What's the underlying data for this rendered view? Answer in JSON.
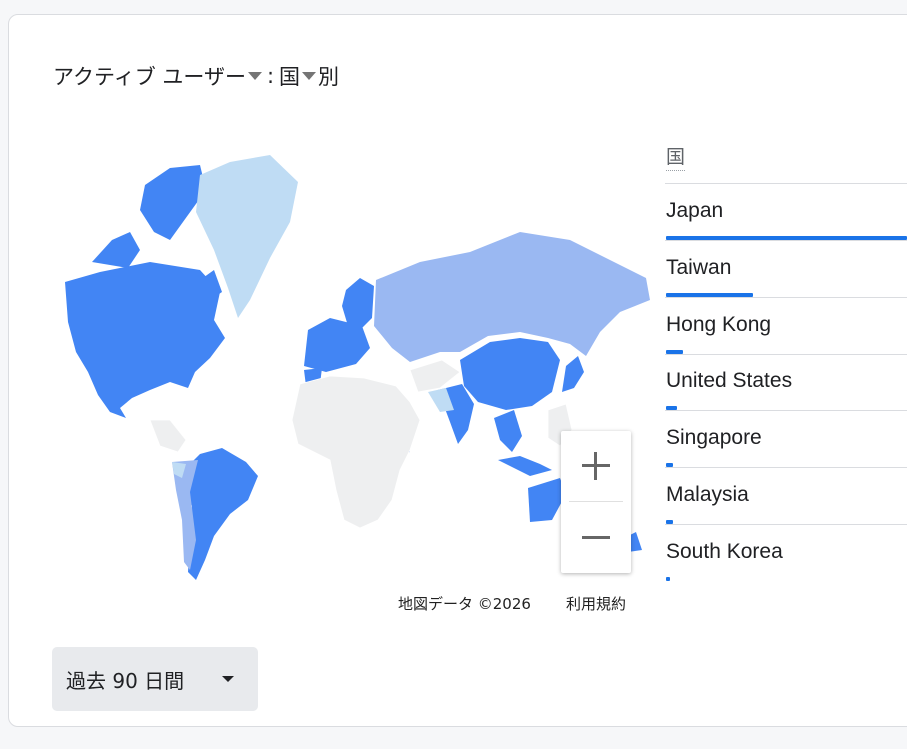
{
  "widget": {
    "metric_label": "アクティブ ユーザー",
    "separator": ":",
    "dimension_label": "国",
    "suffix": "別"
  },
  "map": {
    "attribution": "地図データ ©2026",
    "terms": "利用規約",
    "zoom_in": "+",
    "zoom_out": "−",
    "colors": {
      "high": "#4285f4",
      "mid": "#9ab8f2",
      "low": "#bfdcf4",
      "none": "#eeeff0"
    }
  },
  "table": {
    "header": "国",
    "rows": [
      {
        "country": "Japan",
        "share": 1.0
      },
      {
        "country": "Taiwan",
        "share": 0.36
      },
      {
        "country": "Hong Kong",
        "share": 0.07
      },
      {
        "country": "United States",
        "share": 0.045
      },
      {
        "country": "Singapore",
        "share": 0.03
      },
      {
        "country": "Malaysia",
        "share": 0.03
      },
      {
        "country": "South Korea",
        "share": 0.015
      }
    ]
  },
  "date_range": {
    "label": "過去 90 日間"
  }
}
